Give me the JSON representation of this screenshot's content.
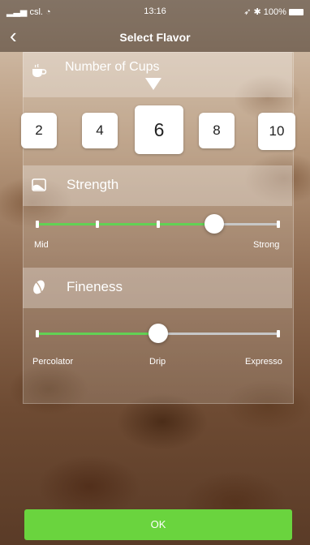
{
  "status": {
    "carrier": "csl.",
    "time": "13:16",
    "battery": "100%"
  },
  "nav": {
    "back_icon": "‹",
    "title": "Select Flavor"
  },
  "cups": {
    "header": "Number of Cups",
    "options": [
      "2",
      "4",
      "6",
      "8",
      "10"
    ],
    "selected": "6"
  },
  "strength": {
    "header": "Strength",
    "min_label": "Mid",
    "max_label": "Strong",
    "value": 0.73
  },
  "fineness": {
    "header": "Fineness",
    "labels": [
      "Percolator",
      "Drip",
      "Expresso"
    ],
    "value": 0.5
  },
  "actions": {
    "ok_label": "OK"
  },
  "colors": {
    "accent_green": "#62d154",
    "ok_button": "#6ad43e"
  }
}
